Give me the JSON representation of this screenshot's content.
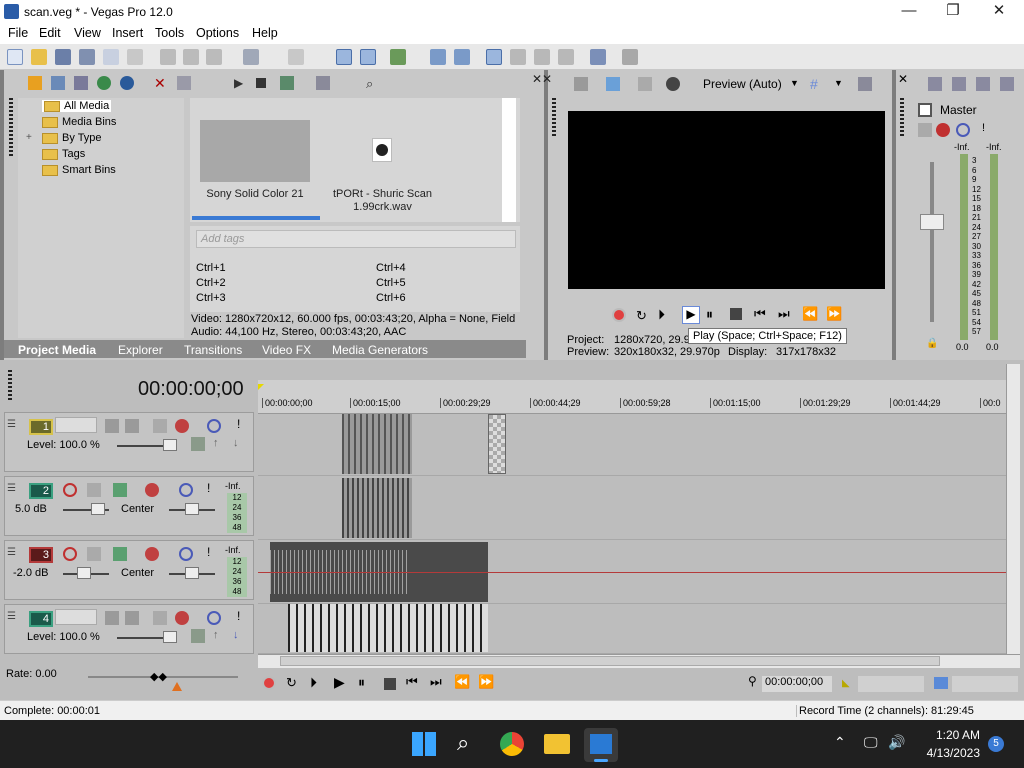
{
  "window": {
    "title": "scan.veg * - Vegas Pro 12.0",
    "minimize": "—",
    "maximize": "❐",
    "close": "✕"
  },
  "menu": [
    "File",
    "Edit",
    "View",
    "Insert",
    "Tools",
    "Options",
    "Help"
  ],
  "explorer": {
    "tree": [
      "All Media",
      "Media Bins",
      "By Type",
      "Tags",
      "Smart Bins"
    ],
    "expander": "+",
    "media_items": [
      {
        "name": "Sony Solid Color 21"
      },
      {
        "name": "tPORt - Shuric Scan 1.99crk.wav"
      }
    ],
    "tags_placeholder": "Add tags",
    "shortcuts": [
      "Ctrl+1",
      "Ctrl+2",
      "Ctrl+3",
      "Ctrl+4",
      "Ctrl+5",
      "Ctrl+6"
    ],
    "info_video": "Video: 1280x720x12, 60.000 fps, 00:03:43;20, Alpha = None, Field",
    "info_audio": "Audio: 44,100 Hz, Stereo, 00:03:43;20, AAC",
    "tabs": [
      "Project Media",
      "Explorer",
      "Transitions",
      "Video FX",
      "Media Generators"
    ]
  },
  "preview": {
    "mode": "Preview (Auto)",
    "project_label": "Project:",
    "project_value": "1280x720, 29.9",
    "preview_label": "Preview:",
    "preview_value": "320x180x32, 29.970p",
    "display_label": "Display:",
    "display_value": "317x178x32",
    "tooltip": "Play (Space; Ctrl+Space; F12)"
  },
  "mixer": {
    "title": "Master",
    "inf_left": "-Inf.",
    "inf_right": "-Inf.",
    "scale": [
      "3",
      "6",
      "9",
      "12",
      "15",
      "18",
      "21",
      "24",
      "27",
      "30",
      "33",
      "36",
      "39",
      "42",
      "45",
      "48",
      "51",
      "54",
      "57"
    ],
    "val_left": "0.0",
    "val_right": "0.0"
  },
  "timeline": {
    "timecode": "00:00:00;00",
    "ruler": [
      "00:00:00;00",
      "00:00:15;00",
      "00:00:29;29",
      "00:00:44;29",
      "00:00:59;28",
      "00:01:15;00",
      "00:01:29;29",
      "00:01:44;29",
      "00:0"
    ],
    "tracks": [
      {
        "num": "1",
        "kind": "video",
        "level": "Level: 100.0 %"
      },
      {
        "num": "2",
        "kind": "audio",
        "vol": "5.0 dB",
        "pan": "Center",
        "meter_top": "-Inf.",
        "meter": [
          "12",
          "24",
          "36",
          "48"
        ]
      },
      {
        "num": "3",
        "kind": "audio",
        "vol": "-2.0 dB",
        "pan": "Center",
        "meter_top": "-Inf.",
        "meter": [
          "12",
          "24",
          "36",
          "48"
        ]
      },
      {
        "num": "4",
        "kind": "video",
        "level": "Level: 100.0 %"
      }
    ],
    "rate": "Rate: 0.00",
    "cursor_time": "00:00:00;00"
  },
  "status": {
    "left": "Complete: 00:00:01",
    "right": "Record Time (2 channels): 81:29:45"
  },
  "taskbar": {
    "time": "1:20 AM",
    "date": "4/13/2023",
    "badge": "5"
  },
  "colors": {
    "track_video": "#d6c24a",
    "track_audio": "#2f8a6a",
    "track3": "#b43a3a",
    "accent": "#0078d4"
  }
}
